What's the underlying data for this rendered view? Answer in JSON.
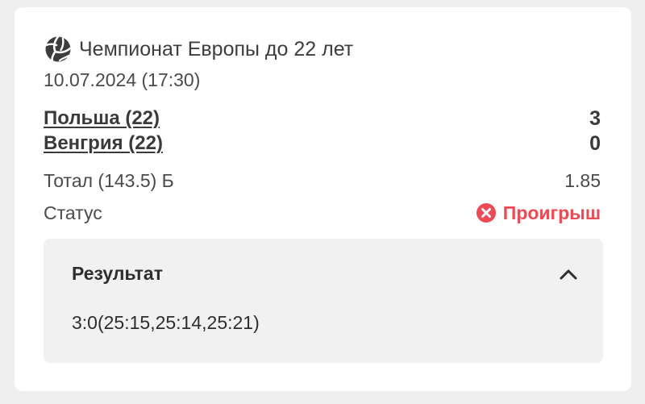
{
  "bet": {
    "tournament": "Чемпионат Европы до 22 лет",
    "sport_icon": "volleyball-icon",
    "datetime": "10.07.2024 (17:30)",
    "teams": [
      {
        "name": "Польша (22)",
        "score": "3"
      },
      {
        "name": "Венгрия (22)",
        "score": "0"
      }
    ],
    "market": "Тотал (143.5) Б",
    "odds": "1.85",
    "status_label": "Статус",
    "status_value": "Проигрыш",
    "status_icon": "x-circle-icon"
  },
  "result": {
    "title": "Результат",
    "value": "3:0(25:15,25:14,25:21)",
    "toggle_icon": "chevron-up-icon"
  },
  "colors": {
    "page_background": "#efefef",
    "card_background": "#ffffff",
    "text": "#3a3a3a",
    "loss": "#ec4a55",
    "result_background": "#f1f1f1"
  }
}
